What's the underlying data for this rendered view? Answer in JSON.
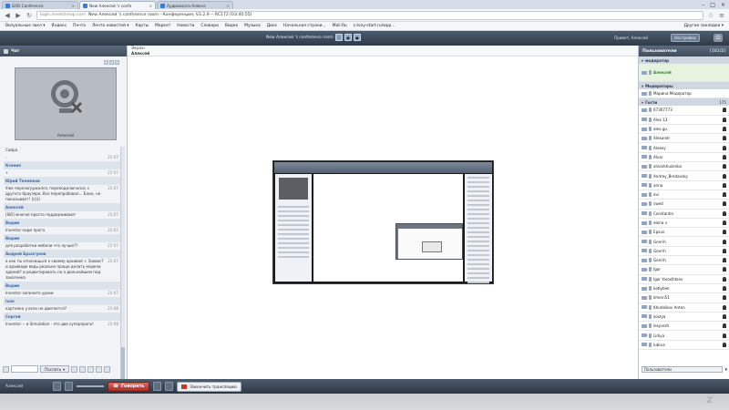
{
  "browser": {
    "tabs": [
      {
        "label": "GVO Conference",
        "active": false
      },
      {
        "label": "New Алексей 's confe",
        "active": true
      },
      {
        "label": "Аудиокасса Алексе",
        "active": false
      }
    ],
    "url_host": "login.meetcheap.com",
    "url_title": "New Алексей 's conference room - Конференция, V3.2.9 -- RC172 [03:40:55]",
    "bookmarks": [
      "Визуальные закл ▾",
      "Яндекс",
      "Почта",
      "Лента новостей ▾",
      "Карты",
      "Маркет",
      "Новости",
      "Словари",
      "Видео",
      "Музыка",
      "Диск",
      "Начальная страни...",
      "Mail.Ru",
      "s.tvoy-start.ru/wpp..."
    ],
    "bookmarks_other": "Другие закладки ▾"
  },
  "app": {
    "room_title": "New Алексей 's conference room",
    "greeting": "Привет, Алексей",
    "settings_label": "Настройки",
    "toolbar": [
      {
        "label": "Чат",
        "icon": "chat-icon"
      },
      {
        "label": "Показ экрана",
        "icon": "screen-share-icon"
      },
      {
        "label": "Вебкам",
        "icon": "webcam-icon"
      },
      {
        "label": "Экран",
        "icon": "screen-icon"
      }
    ]
  },
  "chat": {
    "title": "Чат",
    "video_name": "Алексей",
    "messages": [
      {
        "type": "text",
        "text": "Сайра",
        "time": ""
      },
      {
        "type": "text",
        "text": "-",
        "time": "21:07"
      },
      {
        "type": "name",
        "text": "Ксения",
        "time": ""
      },
      {
        "type": "text",
        "text": "+",
        "time": "21:07"
      },
      {
        "type": "name",
        "text": "Юрий Телемков",
        "time": ""
      },
      {
        "type": "text",
        "text": "Уже перезагружался, переподключался, с другого браузера. Все перепробовал... Блин, не показывает! ))))))",
        "time": "21:07"
      },
      {
        "type": "name",
        "text": "Алексей",
        "time": ""
      },
      {
        "type": "text",
        "text": "[SKI] многие просто поддерживают",
        "time": "21:07"
      },
      {
        "type": "name",
        "text": "Вадим",
        "time": ""
      },
      {
        "type": "text",
        "text": "Inventor норм прога",
        "time": "21:07"
      },
      {
        "type": "name",
        "text": "Вадим",
        "time": ""
      },
      {
        "type": "text",
        "text": "для разработки мебели что лучше??",
        "time": "21:07"
      },
      {
        "type": "name",
        "text": "Андрей Брызгунов",
        "time": ""
      },
      {
        "type": "text",
        "text": "а как ты относишься к своему архиваd + Захвес? и архиваде ведь реально проще делать модели зданий? и редактировать по о дальнейшем под заказчика",
        "time": "21:07"
      },
      {
        "type": "name",
        "text": "Вадим",
        "time": ""
      },
      {
        "type": "text",
        "text": "Inventor запилите уроки",
        "time": "21:07"
      },
      {
        "type": "name",
        "text": "ivan",
        "time": ""
      },
      {
        "type": "text",
        "text": "картинка у всех не двигается?",
        "time": "21:08"
      },
      {
        "type": "name",
        "text": "Сергей",
        "time": ""
      },
      {
        "type": "text",
        "text": "Inventor -- и Simulation - это две суперпроги!",
        "time": "21:08"
      }
    ],
    "send_label": "Послать"
  },
  "screen": {
    "title": "Экран",
    "presenter": "Алексей"
  },
  "users": {
    "title": "Пользователи",
    "count": "[161/2]",
    "groups": {
      "moderators_label": "модератор",
      "me": "Алексей",
      "mods_label": "Модераторы",
      "mods": [
        "Марина Модератор"
      ],
      "guests_label": "Гости",
      "guests_count": "175"
    },
    "guests": [
      "67367773",
      "Alex 13",
      "alex gu",
      "Alexandr",
      "Alexey",
      "Alvar",
      "alviarkhuzenko",
      "Andrey_Bredavsky",
      "anna",
      "avi",
      "cwed",
      "Constantin",
      "elena v",
      "Epsun",
      "Genrih",
      "Genrih",
      "Genrih",
      "Igor",
      "Igor Yaroslhtsev",
      "katlybek",
      "khenn51",
      "Khudaikov Anton",
      "kostya",
      "lesyarsh",
      "Lidiya",
      "lubrus"
    ],
    "filter_label": "Пользователи"
  },
  "bottom": {
    "my_name": "Алексей",
    "talk_label": "Говорить",
    "end_label": "Закончить трансляцию"
  }
}
